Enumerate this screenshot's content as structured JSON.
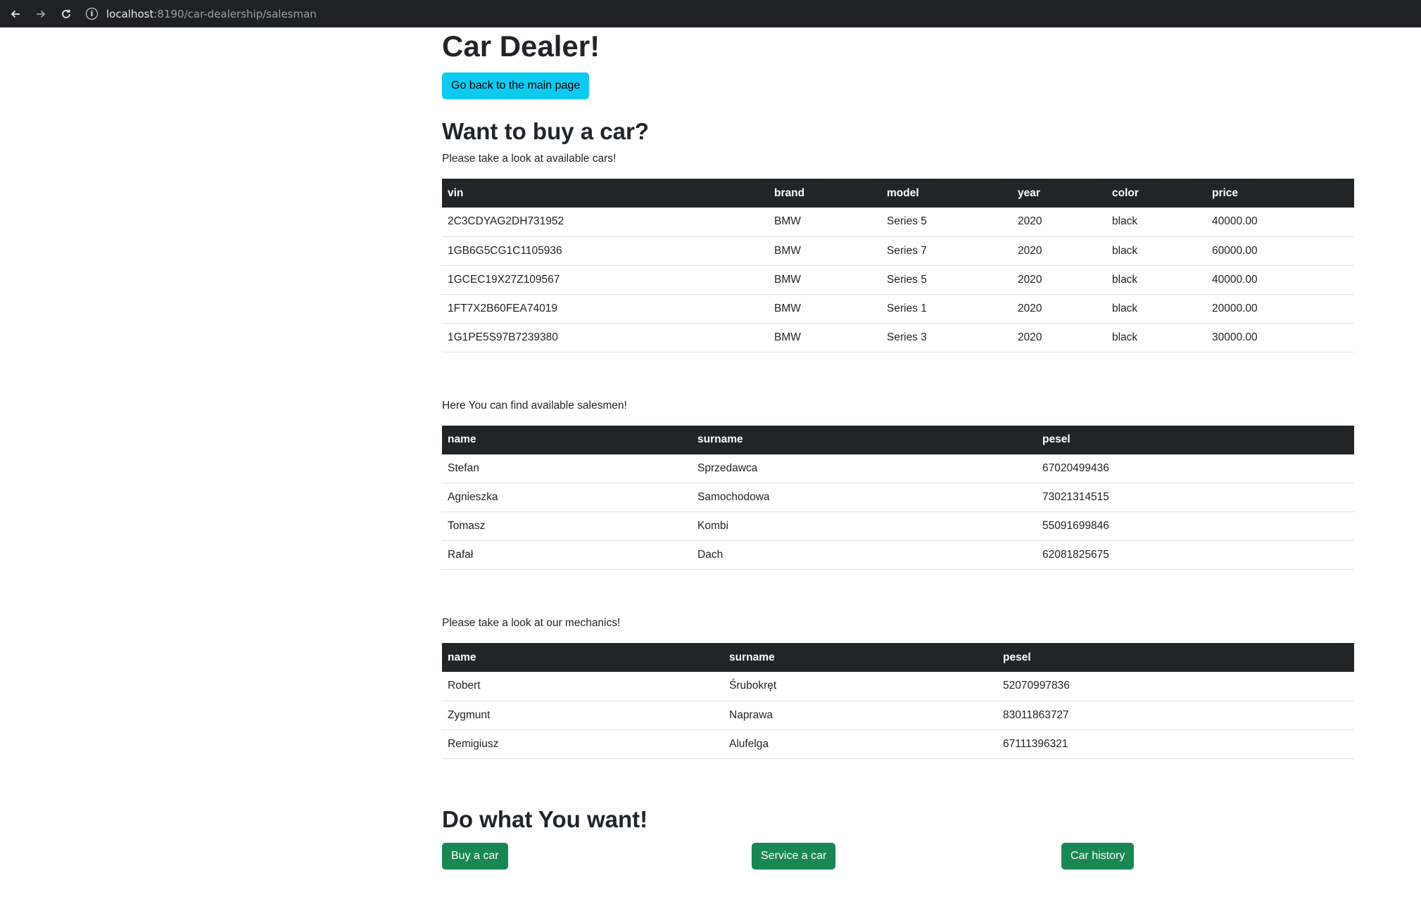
{
  "browser": {
    "url_host": "localhost",
    "url_path": ":8190/car-dealership/salesman"
  },
  "page": {
    "title": "Car Dealer!",
    "back_button": "Go back to the main page",
    "buy_heading": "Want to buy a car?",
    "cars_intro": "Please take a look at available cars!",
    "salesmen_intro": "Here You can find available salesmen!",
    "mechanics_intro": "Please take a look at our mechanics!",
    "actions_heading": "Do what You want!"
  },
  "cars": {
    "headers": [
      "vin",
      "brand",
      "model",
      "year",
      "color",
      "price"
    ],
    "rows": [
      [
        "2C3CDYAG2DH731952",
        "BMW",
        "Series 5",
        "2020",
        "black",
        "40000.00"
      ],
      [
        "1GB6G5CG1C1105936",
        "BMW",
        "Series 7",
        "2020",
        "black",
        "60000.00"
      ],
      [
        "1GCEC19X27Z109567",
        "BMW",
        "Series 5",
        "2020",
        "black",
        "40000.00"
      ],
      [
        "1FT7X2B60FEA74019",
        "BMW",
        "Series 1",
        "2020",
        "black",
        "20000.00"
      ],
      [
        "1G1PE5S97B7239380",
        "BMW",
        "Series 3",
        "2020",
        "black",
        "30000.00"
      ]
    ]
  },
  "salesmen": {
    "headers": [
      "name",
      "surname",
      "pesel"
    ],
    "rows": [
      [
        "Stefan",
        "Sprzedawca",
        "67020499436"
      ],
      [
        "Agnieszka",
        "Samochodowa",
        "73021314515"
      ],
      [
        "Tomasz",
        "Kombi",
        "55091699846"
      ],
      [
        "Rafał",
        "Dach",
        "62081825675"
      ]
    ]
  },
  "mechanics": {
    "headers": [
      "name",
      "surname",
      "pesel"
    ],
    "rows": [
      [
        "Robert",
        "Śrubokręt",
        "52070997836"
      ],
      [
        "Zygmunt",
        "Naprawa",
        "83011863727"
      ],
      [
        "Remigiusz",
        "Alufelga",
        "67111396321"
      ]
    ]
  },
  "actions": {
    "buy": "Buy a car",
    "service": "Service a car",
    "history": "Car history"
  },
  "colors": {
    "info_button": "#0dcaf0",
    "success_button": "#198754",
    "table_header": "#212529",
    "browser_bar": "#202124"
  }
}
